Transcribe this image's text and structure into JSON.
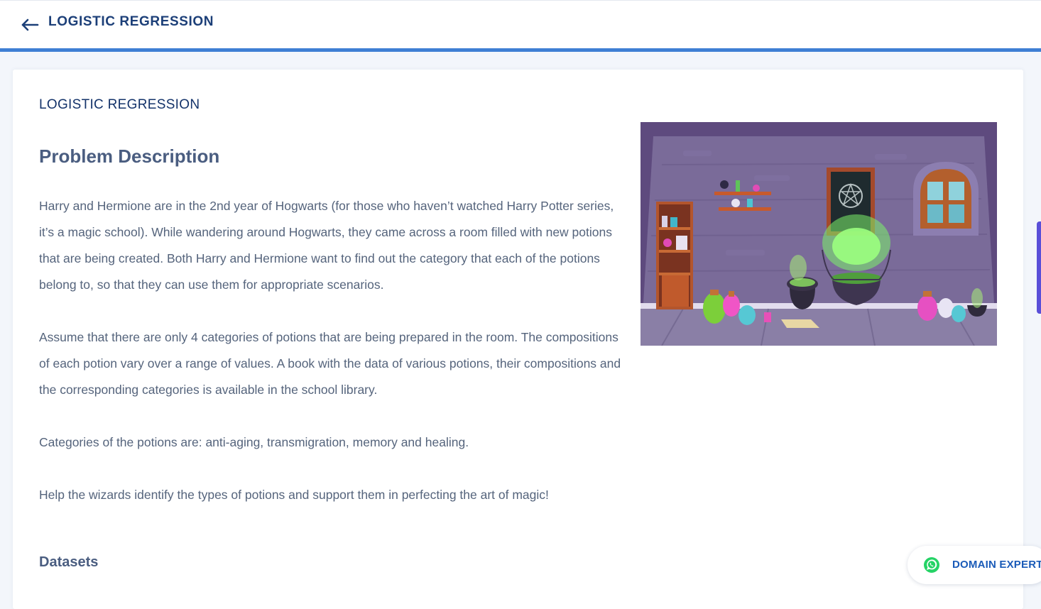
{
  "header": {
    "title": "LOGISTIC REGRESSION",
    "back_icon": "arrow-left-icon",
    "accent_color": "#3f7fd4"
  },
  "main": {
    "section_title": "LOGISTIC REGRESSION",
    "problem_heading": "Problem Description",
    "paragraphs": [
      "Harry and Hermione are in the 2nd year of Hogwarts (for those who haven’t watched Harry Potter series, it’s a magic school). While wandering around Hogwarts, they came across a room filled with new potions that are being created. Both Harry and Hermione want to find out the category that each of the potions belong to, so that they can use them for appropriate scenarios.",
      "Assume that there are only 4 categories of potions that are being prepared in the room. The compositions of each potion vary over a range of values. A book with the data of various potions, their compositions and the corresponding categories is available in the school library.",
      "Categories of the potions are: anti-aging, transmigration, memory and healing.",
      "Help the wizards identify the types of potions and support them in perfecting the art of magic!"
    ],
    "datasets_heading": "Datasets",
    "illustration": "potion-room-illustration"
  },
  "floating": {
    "domain_expert_label": "DOMAIN EXPERT",
    "domain_expert_icon": "whatsapp-icon",
    "whatsapp_color": "#25d366"
  }
}
